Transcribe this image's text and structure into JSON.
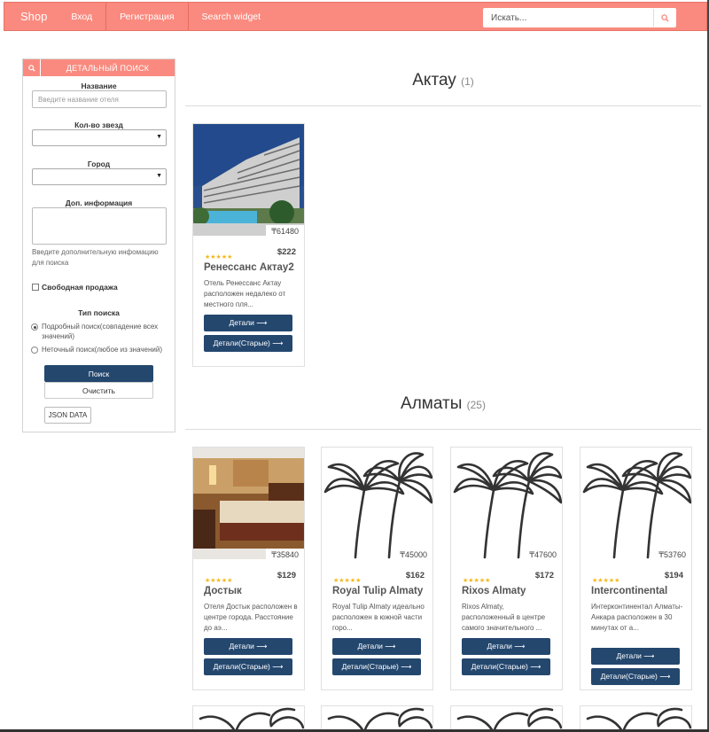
{
  "navbar": {
    "brand": "Shop",
    "links": [
      "Вход",
      "Регистрация",
      "Search widget"
    ],
    "search_placeholder": "Искать..."
  },
  "filter": {
    "title": "ДЕТАЛЬНЫЙ ПОИСК",
    "name_label": "Название",
    "name_placeholder": "Введите название отеля",
    "stars_label": "Кол-во звезд",
    "city_label": "Город",
    "info_label": "Доп. информация",
    "info_hint": "Введите дополнительную инфомацию для поиска",
    "free_sale_label": "Свободная продажа",
    "search_type_label": "Тип поиска",
    "radio_options": [
      {
        "label": "Подробный поиск(совпадение всех значений)",
        "selected": true
      },
      {
        "label": "Неточный поиск(любое из значений)",
        "selected": false
      }
    ],
    "search_button": "Поиск",
    "clear_button": "Очистить",
    "json_button": "JSON DATA"
  },
  "sections": [
    {
      "city": "Актау",
      "count": "(1)",
      "hotels": [
        {
          "price_local": "₸61480",
          "price_usd": "$222",
          "stars": "★★★★★",
          "name": "Ренессанс Актау2",
          "desc": "Отель Ренессанс Актау расположен недалеко от местного пля...",
          "image": "hotel-building",
          "buttons": [
            "Детали ⟶",
            "Детали(Старые) ⟶"
          ]
        }
      ]
    },
    {
      "city": "Алматы",
      "count": "(25)",
      "hotels": [
        {
          "price_local": "₸35840",
          "price_usd": "$129",
          "stars": "★★★★★",
          "name": "Достык",
          "desc": "Отеля Достык расположен в центре города. Расстояние до аэ...",
          "image": "hotel-room",
          "buttons": [
            "Детали ⟶",
            "Детали(Старые) ⟶"
          ]
        },
        {
          "price_local": "₸45000",
          "price_usd": "$162",
          "stars": "★★★★★",
          "name": "Royal Tulip Almaty",
          "desc": "Royal Tulip Almaty идеально расположен в южной части горо...",
          "image": "palm-icon",
          "buttons": [
            "Детали ⟶",
            "Детали(Старые) ⟶"
          ]
        },
        {
          "price_local": "₸47600",
          "price_usd": "$172",
          "stars": "★★★★★",
          "name": "Rixos Almaty",
          "desc": "Rixos Almaty, расположенный в центре самого значительного ...",
          "image": "palm-icon",
          "buttons": [
            "Детали ⟶",
            "Детали(Старые) ⟶"
          ]
        },
        {
          "price_local": "₸53760",
          "price_usd": "$194",
          "stars": "★★★★★",
          "name": "Intercontinental",
          "desc": "Интерконтинентал Алматы-Анкара расположен в 30 минутах от а...",
          "image": "palm-icon",
          "buttons": [
            "Детали ⟶",
            "Детали(Старые) ⟶"
          ]
        }
      ]
    }
  ],
  "colors": {
    "accent": "#fa8a7f",
    "button": "#24476e",
    "star": "#f3b81b"
  }
}
